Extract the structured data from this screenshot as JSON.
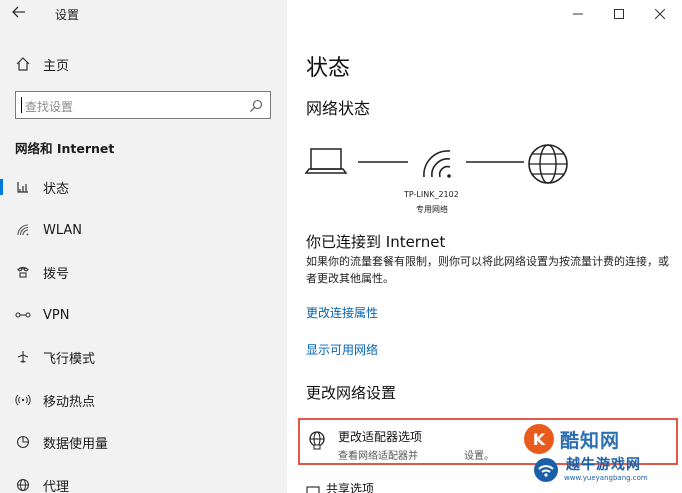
{
  "window": {
    "title": "设置",
    "back_icon": "back-arrow-icon",
    "controls": [
      "minimize-icon",
      "maximize-icon",
      "close-icon"
    ]
  },
  "sidebar": {
    "home": "主页",
    "search_placeholder": "查找设置",
    "section": "网络和 Internet",
    "items": [
      {
        "label": "状态",
        "icon": "status-icon",
        "active": true
      },
      {
        "label": "WLAN",
        "icon": "wifi-icon"
      },
      {
        "label": "拨号",
        "icon": "dialup-icon"
      },
      {
        "label": "VPN",
        "icon": "vpn-icon"
      },
      {
        "label": "飞行模式",
        "icon": "airplane-icon"
      },
      {
        "label": "移动热点",
        "icon": "hotspot-icon"
      },
      {
        "label": "数据使用量",
        "icon": "data-usage-icon"
      },
      {
        "label": "代理",
        "icon": "globe-icon"
      }
    ]
  },
  "main": {
    "title": "状态",
    "network_status_heading": "网络状态",
    "network_name": "TP-LINK_2102",
    "network_type": "专用网络",
    "connected_title": "你已连接到 Internet",
    "connected_desc": "如果你的流量套餐有限制，则你可以将此网络设置为按流量计费的连接，或者更改其他属性。",
    "link_change_props": "更改连接属性",
    "link_show_networks": "显示可用网络",
    "change_settings_heading": "更改网络设置",
    "adapter_title": "更改适配器选项",
    "adapter_desc": "查看网络适配器并",
    "adapter_desc_tail": "设置。",
    "share_label": "共享选项"
  },
  "watermark": {
    "brand": "酷知网",
    "brand2": "越牛游戏网",
    "url": "www.yueyangbang.com"
  },
  "colors": {
    "accent": "#0078d7",
    "link": "#0063b1",
    "highlight": "#e0584a"
  }
}
